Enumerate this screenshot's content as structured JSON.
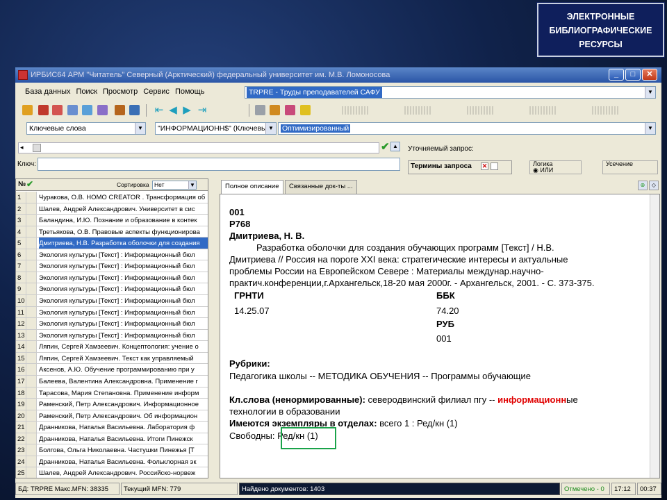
{
  "slide": {
    "title": "ЭЛЕКТРОННЫЕ\nБИБЛИОГРАФИЧЕСКИЕ\nРЕСУРСЫ"
  },
  "window": {
    "title": "ИРБИС64   АРМ \"Читатель\"   Северный (Арктический) федеральный университет им. М.В. Ломоносова",
    "menu": [
      "База данных",
      "Поиск",
      "Просмотр",
      "Сервис",
      "Помощь"
    ],
    "database": "TRPRE - Труды преподавателей САФУ",
    "search_field": "Ключевые слова",
    "search_term": "\"ИНФОРМАЦИОНН$\" (Ключевы",
    "search_mode": "Оптимизированный",
    "key_label": "Ключ:",
    "refined_query_label": "Уточняемый запрос:",
    "terms_label": "Термины запроса",
    "logic_label": "Логика",
    "logic_value": "ИЛИ",
    "truncation_label": "Усечение"
  },
  "list": {
    "header_num": "№",
    "sort_label": "Сортировка",
    "sort_value": "Нет",
    "rows": [
      {
        "n": "1",
        "text": "Чуракова, О.В. HOMO CREATOR . Трансформация об"
      },
      {
        "n": "2",
        "text": "Шалев, Андрей Александрович. Университет в сис"
      },
      {
        "n": "3",
        "text": "Баландина, И.Ю. Познание и образование в контек"
      },
      {
        "n": "4",
        "text": "Третьякова, О.В. Правовые аспекты функционирова"
      },
      {
        "n": "5",
        "text": "Дмитриева, Н.В. Разработка оболочки для создания"
      },
      {
        "n": "6",
        "text": "Экология культуры [Текст] : Информационный бюл"
      },
      {
        "n": "7",
        "text": "Экология культуры [Текст] : Информационный бюл"
      },
      {
        "n": "8",
        "text": "Экология культуры [Текст] : Информационный бюл"
      },
      {
        "n": "9",
        "text": "Экология культуры [Текст] : Информационный бюл"
      },
      {
        "n": "10",
        "text": "Экология культуры [Текст] : Информационный бюл"
      },
      {
        "n": "11",
        "text": "Экология культуры [Текст] : Информационный бюл"
      },
      {
        "n": "12",
        "text": "Экология культуры [Текст] : Информационный бюл"
      },
      {
        "n": "13",
        "text": "Экология культуры [Текст] : Информационный бюл"
      },
      {
        "n": "14",
        "text": "Ляпин, Сергей Хамзеевич. Концептология: учение о"
      },
      {
        "n": "15",
        "text": "Ляпин, Сергей Хамзеевич. Текст как управляемый"
      },
      {
        "n": "16",
        "text": "Аксенов, А.Ю. Обучение программированию при у"
      },
      {
        "n": "17",
        "text": "Балеева, Валентина Александровна. Применение г"
      },
      {
        "n": "18",
        "text": "Тарасова, Мария Степановна. Применение информ"
      },
      {
        "n": "19",
        "text": "Раменский, Петр Александрович. Информационное"
      },
      {
        "n": "20",
        "text": "Раменский, Петр Александрович. Об информацион"
      },
      {
        "n": "21",
        "text": "Дранникова, Наталья Васильевна. Лаборатория ф"
      },
      {
        "n": "22",
        "text": "Дранникова, Наталья Васильевна. Итоги Пинежск"
      },
      {
        "n": "23",
        "text": "Болгова, Ольга Николаевна. Частушки Пинежья [Т"
      },
      {
        "n": "24",
        "text": "Дранникова, Наталья Васильевна. Фольклорная эк"
      },
      {
        "n": "25",
        "text": "Шалев, Андрей Александрович. Российско-норвеж"
      }
    ]
  },
  "tabs": [
    "Полное описание",
    "Связанные док-ты ..."
  ],
  "record": {
    "line1": "001",
    "line2": "Р768",
    "author": "Дмитриева, Н. В.",
    "desc1": "Разработка оболочки для создания обучающих программ [Текст] / Н.В.",
    "desc2": "Дмитриева // Россия на пороге XXI века: стратегические интересы и актуальные",
    "desc3": "проблемы России на Европейском Севере : Материалы междунар.научно-",
    "desc4": "практич.конференции,г.Архангельск,18-20 мая 2000г. - Архангельск, 2001. - С. 373-375.",
    "grnti_label": "ГРНТИ",
    "grnti_value": "14.25.07",
    "bbk_label": "ББК",
    "bbk_value": "74.20",
    "rub_label": "РУБ",
    "rub_value": "001",
    "rubrics_label": "Рубрики:",
    "rubrics_value": "Педагогика школы -- МЕТОДИКА ОБУЧЕНИЯ -- Программы обучающие",
    "kw_label": "Кл.слова (ненормированные):",
    "kw_pre": " северодвинский филиал пгу -- ",
    "kw_hit": "информационн",
    "kw_post": "ые",
    "kw_line2": "технологии в образовании",
    "copies_label": "Имеются экземпляры в отделах:",
    "copies_value": " всего 1 : Ред/кн (1)",
    "free_label": "Свободны: ",
    "free_value": "Ред/кн (1)"
  },
  "status": {
    "db": "БД: TRPRE Макс.MFN: 38335",
    "mfn": "Текущий MFN: 779",
    "found": "Найдено документов: 1403",
    "marked": "Отмечено - 0",
    "time": "17:12",
    "elapsed": "00:37"
  },
  "colors": {
    "selection": "#316ac5",
    "highlight": "#e00000",
    "frame": "#1aa34a"
  }
}
